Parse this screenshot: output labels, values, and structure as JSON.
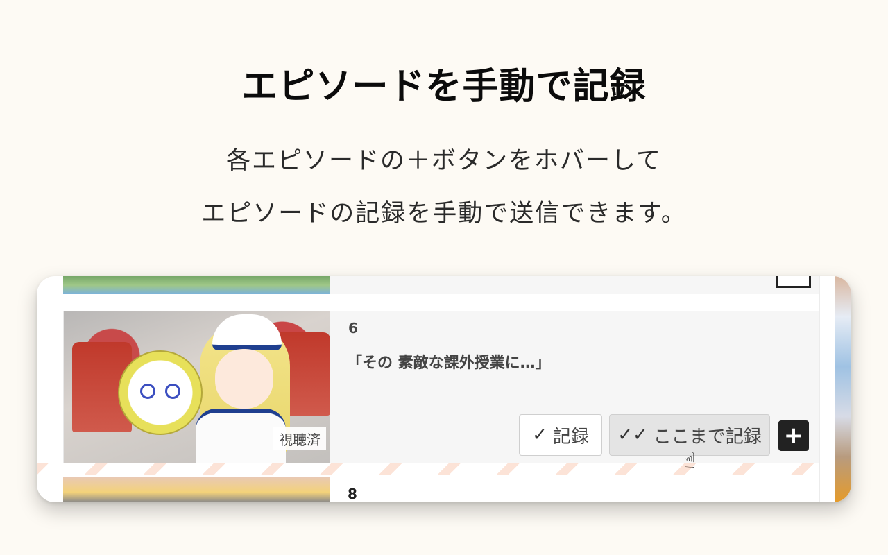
{
  "headline": "エピソードを手動で記録",
  "description": {
    "line1": "各エピソードの＋ボタンをホバーして",
    "line2": "エピソードの記録を手動で送信できます。"
  },
  "episode_current": {
    "number": "6",
    "title": "「その 素敵な課外授業に…」",
    "watched_badge": "視聴済",
    "buttons": {
      "record_label": "記録",
      "record_until_label": "ここまで記録",
      "plus_label": "+"
    },
    "icons": {
      "record": "check-icon",
      "record_until": "double-check-icon",
      "cursor": "hand-pointer-icon"
    }
  },
  "episode_next": {
    "number": "8"
  },
  "colors": {
    "background": "#fdfaf4",
    "plus_button": "#222222",
    "hover_button": "#e4e4e4"
  }
}
